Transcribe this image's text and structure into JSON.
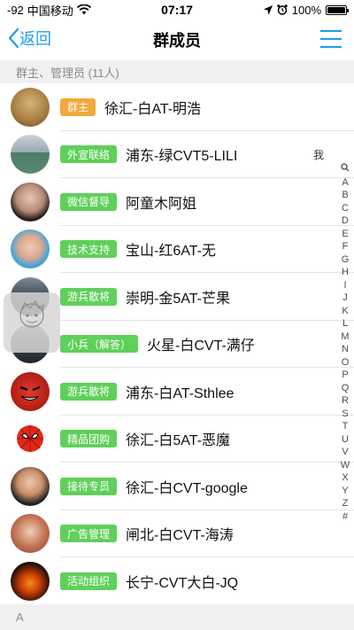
{
  "status_bar": {
    "signal": "-92",
    "carrier": "中国移动",
    "time": "07:17",
    "battery": "100%",
    "battery_level": 1.0,
    "icons": [
      "wifi-icon",
      "location-icon",
      "alarm-icon",
      "battery-icon"
    ]
  },
  "nav": {
    "back_label": "返回",
    "title": "群成员",
    "menu_icon": "hamburger-menu-icon",
    "accent_color": "#1a9df0"
  },
  "section_header": "群主、管理员 (11人)",
  "members": [
    {
      "badge": "群主",
      "badge_color": "#f2a93b",
      "name": "徐汇-白AT-明浩",
      "me": ""
    },
    {
      "badge": "外宣联络",
      "badge_color": "#5fd05a",
      "name": "浦东-绿CVT5-LILI",
      "me": "我"
    },
    {
      "badge": "微信督导",
      "badge_color": "#5fd05a",
      "name": "阿童木阿姐",
      "me": ""
    },
    {
      "badge": "技术支持",
      "badge_color": "#5fd05a",
      "name": "宝山-红6AT-无",
      "me": ""
    },
    {
      "badge": "游兵散将",
      "badge_color": "#5fd05a",
      "name": "崇明-金5AT-芒果",
      "me": ""
    },
    {
      "badge": "小兵（解答）",
      "badge_color": "#5fd05a",
      "name": "火星-白CVT-满仔",
      "me": ""
    },
    {
      "badge": "游兵散将",
      "badge_color": "#5fd05a",
      "name": "浦东-白AT-Sthlee",
      "me": ""
    },
    {
      "badge": "精品团购",
      "badge_color": "#5fd05a",
      "name": "徐汇-白5AT-恶魔",
      "me": ""
    },
    {
      "badge": "接待专员",
      "badge_color": "#5fd05a",
      "name": "徐汇-白CVT-google",
      "me": ""
    },
    {
      "badge": "广告管理",
      "badge_color": "#5fd05a",
      "name": "闸北-白CVT-海涛",
      "me": ""
    },
    {
      "badge": "活动组织",
      "badge_color": "#5fd05a",
      "name": "长宁-CVT大白-JQ",
      "me": ""
    }
  ],
  "next_section_header": "A",
  "alpha_index": [
    "Q",
    "A",
    "B",
    "C",
    "D",
    "E",
    "F",
    "G",
    "H",
    "I",
    "J",
    "K",
    "L",
    "M",
    "N",
    "O",
    "P",
    "Q",
    "R",
    "S",
    "T",
    "U",
    "V",
    "W",
    "X",
    "Y",
    "Z",
    "#"
  ]
}
